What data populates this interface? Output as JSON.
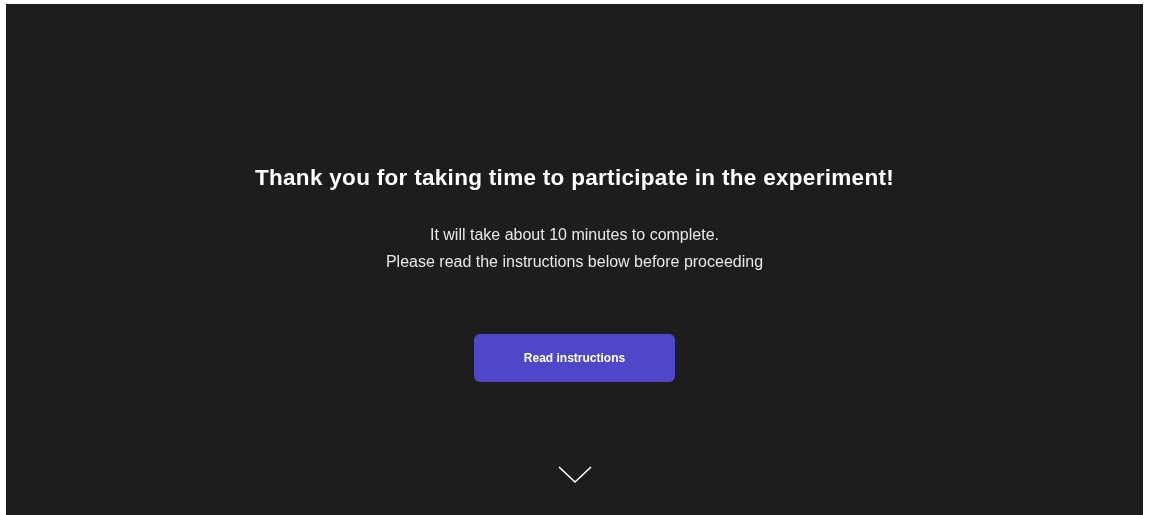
{
  "heading": "Thank you for taking time to participate in the experiment!",
  "lines": [
    "It will take about 10 minutes to complete.",
    "Please read the instructions below before proceeding"
  ],
  "button": {
    "label": "Read instructions"
  }
}
